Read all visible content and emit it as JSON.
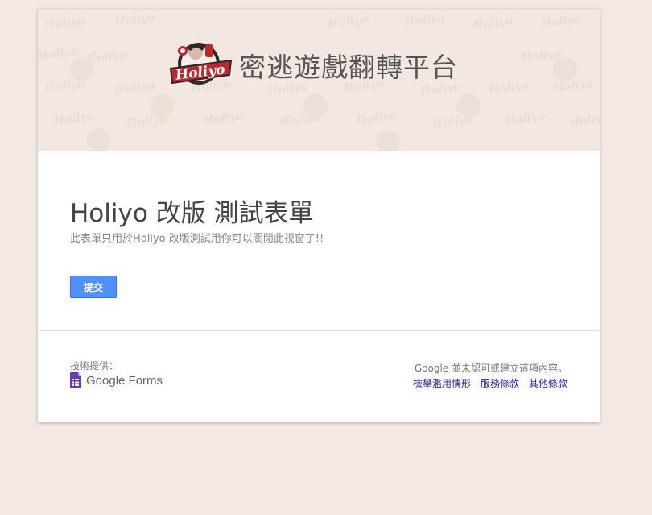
{
  "header": {
    "logo_text": "Holiyo",
    "banner_title": "密逃遊戲翻轉平台",
    "watermark_text": "Holiyo"
  },
  "form": {
    "title": "Holiyo 改版 測試表單",
    "description": "此表單只用於Holiyo 改版測試用你可以關閉此視窗了!!",
    "submit_label": "提交"
  },
  "footer": {
    "powered_by": "技術提供：",
    "brand": "Google Forms",
    "disclaimer": "Google 並未認可或建立這項內容。",
    "links": [
      "檢舉濫用情形",
      "服務條款",
      "其他條款"
    ],
    "separator": " - "
  },
  "colors": {
    "page_background": "#f3e9e2",
    "banner_background": "#f2e8e1",
    "button": "#4d90fe",
    "logo_red": "#c0272d",
    "link": "#1b1f9a"
  },
  "icons": [
    "holiyo-logo",
    "google-forms-icon"
  ]
}
